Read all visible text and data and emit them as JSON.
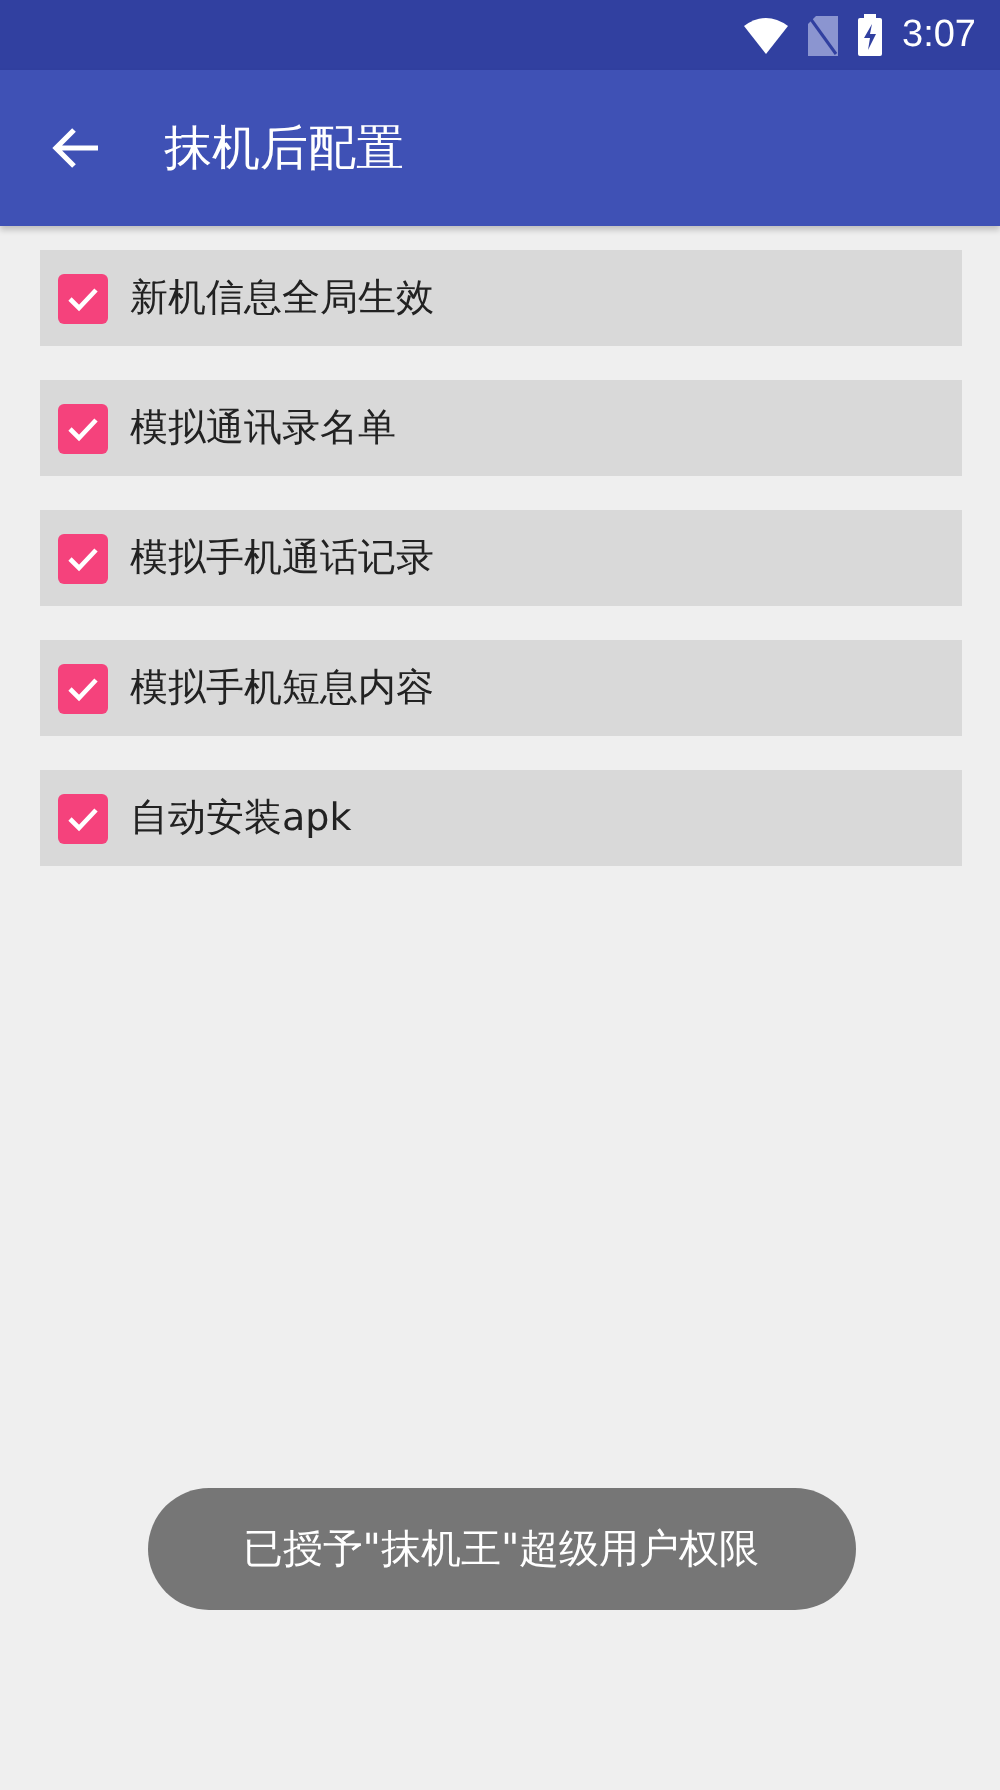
{
  "status_bar": {
    "time": "3:07"
  },
  "app_bar": {
    "title": "抹机后配置"
  },
  "options": [
    {
      "label": "新机信息全局生效",
      "checked": true
    },
    {
      "label": "模拟通讯录名单",
      "checked": true
    },
    {
      "label": "模拟手机通话记录",
      "checked": true
    },
    {
      "label": "模拟手机短息内容",
      "checked": true
    },
    {
      "label": "自动安装apk",
      "checked": true
    }
  ],
  "toast": "已授予\"抹机王\"超级用户权限"
}
